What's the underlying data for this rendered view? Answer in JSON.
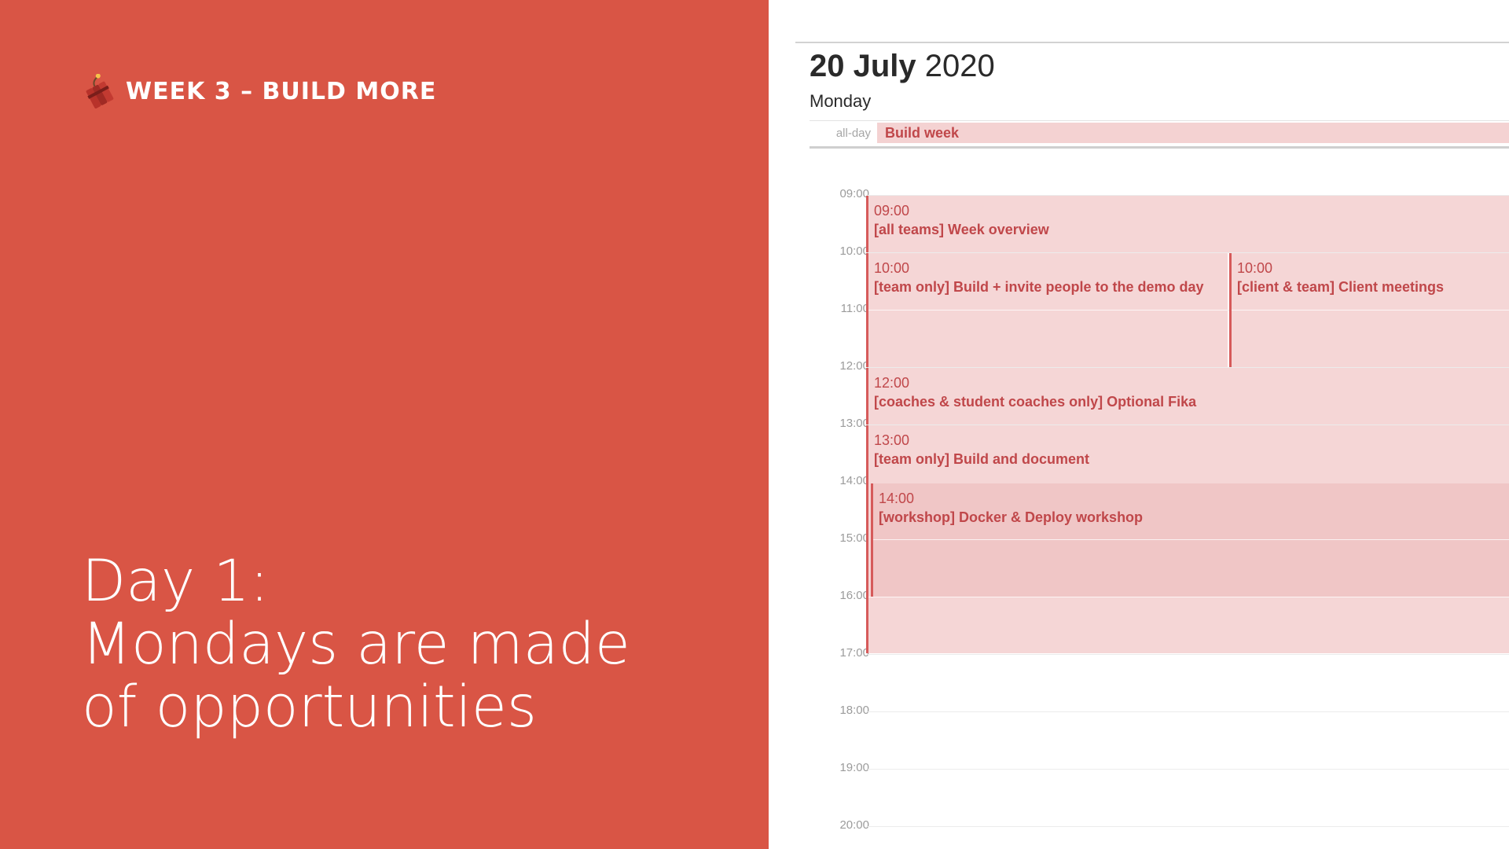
{
  "slide": {
    "week_label": "WEEK 3 – BUILD MORE",
    "title_lines": [
      "Day 1:",
      "Mondays are made",
      "of opportunities"
    ],
    "icon": "dynamite-icon",
    "background": "#d95545"
  },
  "calendar": {
    "day_number": "20 July",
    "year": "2020",
    "weekday": "Monday",
    "allday_label": "all-day",
    "allday_event": "Build week",
    "hours": [
      "09:00",
      "10:00",
      "11:00",
      "12:00",
      "13:00",
      "14:00",
      "15:00",
      "16:00",
      "17:00",
      "18:00",
      "19:00",
      "20:00"
    ],
    "events": [
      {
        "time": "09:00",
        "title": "[all teams] Week overview"
      },
      {
        "time": "10:00",
        "title": "[team only] Build + invite people to the demo day"
      },
      {
        "time": "10:00",
        "title": "[client & team] Client meetings"
      },
      {
        "time": "12:00",
        "title": "[coaches & student coaches only] Optional Fika"
      },
      {
        "time": "13:00",
        "title": "[team only] Build and document"
      },
      {
        "time": "14:00",
        "title": "[workshop] Docker & Deploy workshop"
      }
    ],
    "colors": {
      "event_bg": "#f5d6d6",
      "event_text": "#c0474a",
      "event_border": "#d65a5a"
    }
  }
}
